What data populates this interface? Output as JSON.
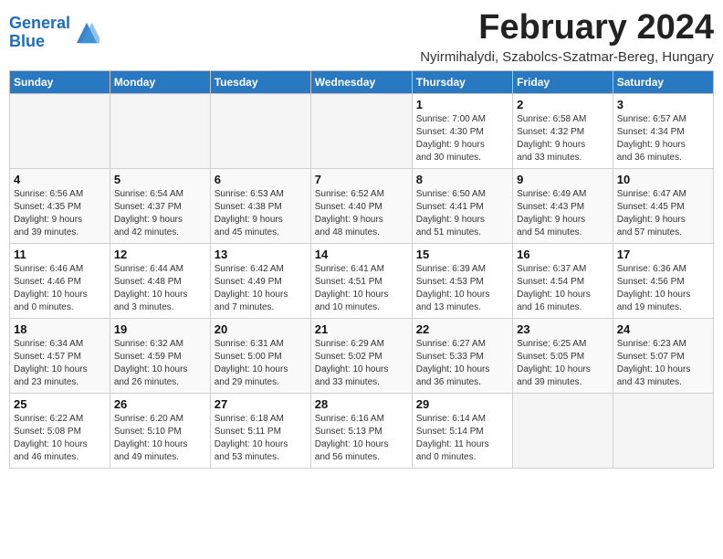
{
  "header": {
    "logo_line1": "General",
    "logo_line2": "Blue",
    "month_title": "February 2024",
    "location": "Nyirmihalydi, Szabolcs-Szatmar-Bereg, Hungary"
  },
  "columns": [
    "Sunday",
    "Monday",
    "Tuesday",
    "Wednesday",
    "Thursday",
    "Friday",
    "Saturday"
  ],
  "weeks": [
    [
      {
        "day": "",
        "info": ""
      },
      {
        "day": "",
        "info": ""
      },
      {
        "day": "",
        "info": ""
      },
      {
        "day": "",
        "info": ""
      },
      {
        "day": "1",
        "info": "Sunrise: 7:00 AM\nSunset: 4:30 PM\nDaylight: 9 hours\nand 30 minutes."
      },
      {
        "day": "2",
        "info": "Sunrise: 6:58 AM\nSunset: 4:32 PM\nDaylight: 9 hours\nand 33 minutes."
      },
      {
        "day": "3",
        "info": "Sunrise: 6:57 AM\nSunset: 4:34 PM\nDaylight: 9 hours\nand 36 minutes."
      }
    ],
    [
      {
        "day": "4",
        "info": "Sunrise: 6:56 AM\nSunset: 4:35 PM\nDaylight: 9 hours\nand 39 minutes."
      },
      {
        "day": "5",
        "info": "Sunrise: 6:54 AM\nSunset: 4:37 PM\nDaylight: 9 hours\nand 42 minutes."
      },
      {
        "day": "6",
        "info": "Sunrise: 6:53 AM\nSunset: 4:38 PM\nDaylight: 9 hours\nand 45 minutes."
      },
      {
        "day": "7",
        "info": "Sunrise: 6:52 AM\nSunset: 4:40 PM\nDaylight: 9 hours\nand 48 minutes."
      },
      {
        "day": "8",
        "info": "Sunrise: 6:50 AM\nSunset: 4:41 PM\nDaylight: 9 hours\nand 51 minutes."
      },
      {
        "day": "9",
        "info": "Sunrise: 6:49 AM\nSunset: 4:43 PM\nDaylight: 9 hours\nand 54 minutes."
      },
      {
        "day": "10",
        "info": "Sunrise: 6:47 AM\nSunset: 4:45 PM\nDaylight: 9 hours\nand 57 minutes."
      }
    ],
    [
      {
        "day": "11",
        "info": "Sunrise: 6:46 AM\nSunset: 4:46 PM\nDaylight: 10 hours\nand 0 minutes."
      },
      {
        "day": "12",
        "info": "Sunrise: 6:44 AM\nSunset: 4:48 PM\nDaylight: 10 hours\nand 3 minutes."
      },
      {
        "day": "13",
        "info": "Sunrise: 6:42 AM\nSunset: 4:49 PM\nDaylight: 10 hours\nand 7 minutes."
      },
      {
        "day": "14",
        "info": "Sunrise: 6:41 AM\nSunset: 4:51 PM\nDaylight: 10 hours\nand 10 minutes."
      },
      {
        "day": "15",
        "info": "Sunrise: 6:39 AM\nSunset: 4:53 PM\nDaylight: 10 hours\nand 13 minutes."
      },
      {
        "day": "16",
        "info": "Sunrise: 6:37 AM\nSunset: 4:54 PM\nDaylight: 10 hours\nand 16 minutes."
      },
      {
        "day": "17",
        "info": "Sunrise: 6:36 AM\nSunset: 4:56 PM\nDaylight: 10 hours\nand 19 minutes."
      }
    ],
    [
      {
        "day": "18",
        "info": "Sunrise: 6:34 AM\nSunset: 4:57 PM\nDaylight: 10 hours\nand 23 minutes."
      },
      {
        "day": "19",
        "info": "Sunrise: 6:32 AM\nSunset: 4:59 PM\nDaylight: 10 hours\nand 26 minutes."
      },
      {
        "day": "20",
        "info": "Sunrise: 6:31 AM\nSunset: 5:00 PM\nDaylight: 10 hours\nand 29 minutes."
      },
      {
        "day": "21",
        "info": "Sunrise: 6:29 AM\nSunset: 5:02 PM\nDaylight: 10 hours\nand 33 minutes."
      },
      {
        "day": "22",
        "info": "Sunrise: 6:27 AM\nSunset: 5:33 PM\nDaylight: 10 hours\nand 36 minutes."
      },
      {
        "day": "23",
        "info": "Sunrise: 6:25 AM\nSunset: 5:05 PM\nDaylight: 10 hours\nand 39 minutes."
      },
      {
        "day": "24",
        "info": "Sunrise: 6:23 AM\nSunset: 5:07 PM\nDaylight: 10 hours\nand 43 minutes."
      }
    ],
    [
      {
        "day": "25",
        "info": "Sunrise: 6:22 AM\nSunset: 5:08 PM\nDaylight: 10 hours\nand 46 minutes."
      },
      {
        "day": "26",
        "info": "Sunrise: 6:20 AM\nSunset: 5:10 PM\nDaylight: 10 hours\nand 49 minutes."
      },
      {
        "day": "27",
        "info": "Sunrise: 6:18 AM\nSunset: 5:11 PM\nDaylight: 10 hours\nand 53 minutes."
      },
      {
        "day": "28",
        "info": "Sunrise: 6:16 AM\nSunset: 5:13 PM\nDaylight: 10 hours\nand 56 minutes."
      },
      {
        "day": "29",
        "info": "Sunrise: 6:14 AM\nSunset: 5:14 PM\nDaylight: 11 hours\nand 0 minutes."
      },
      {
        "day": "",
        "info": ""
      },
      {
        "day": "",
        "info": ""
      }
    ]
  ]
}
